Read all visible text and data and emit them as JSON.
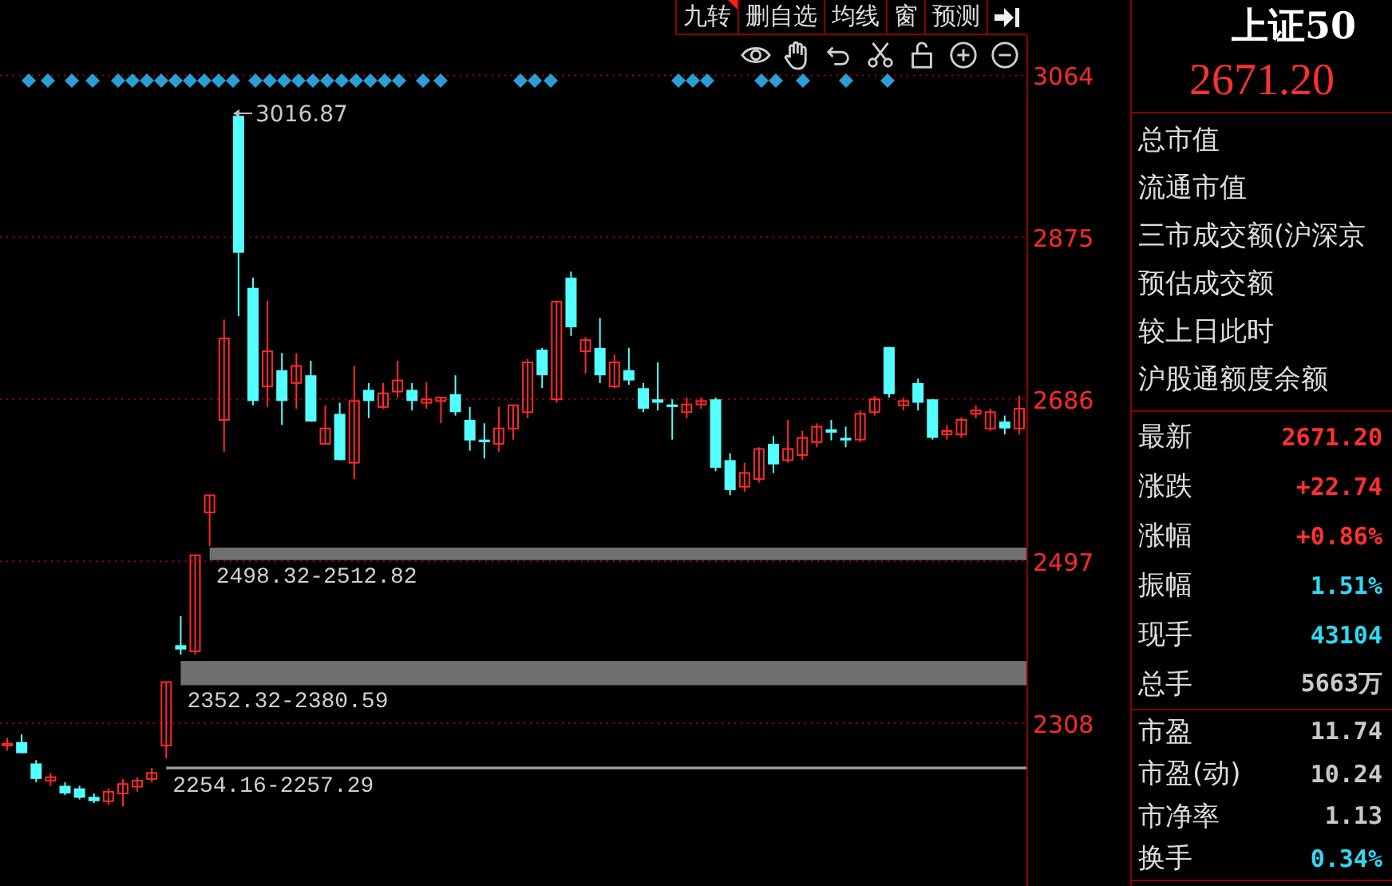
{
  "toolbar": {
    "buttons": [
      {
        "label": "九转",
        "flagged": true
      },
      {
        "label": "删自选",
        "flagged": false
      },
      {
        "label": "均线",
        "flagged": false
      },
      {
        "label": "窗",
        "flagged": false
      },
      {
        "label": "预测",
        "flagged": false
      }
    ]
  },
  "chart": {
    "peak_label": "3016.87",
    "chart_data": {
      "type": "candlestick",
      "grid": true,
      "ylim": [
        2118,
        3111
      ],
      "yticks": [
        {
          "value": 3064,
          "label": "3064"
        },
        {
          "value": 2875,
          "label": "2875"
        },
        {
          "value": 2686,
          "label": "2686"
        },
        {
          "value": 2497,
          "label": "2497"
        },
        {
          "value": 2308,
          "label": "2308"
        }
      ],
      "bands": [
        {
          "axis": "y",
          "from": 2498.32,
          "to": 2512.82,
          "label": "2498.32-2512.82"
        },
        {
          "axis": "y",
          "from": 2352.32,
          "to": 2380.59,
          "label": "2352.32-2380.59"
        },
        {
          "axis": "y",
          "from": 2254.16,
          "to": 2257.29,
          "label": "2254.16-2257.29"
        }
      ],
      "categories": [
        null,
        null,
        null,
        null,
        null,
        null,
        null,
        null,
        null,
        null,
        null,
        null,
        null,
        null,
        null,
        null,
        null,
        null,
        null,
        null,
        null,
        null,
        null,
        null,
        null,
        null,
        null,
        null,
        null,
        null,
        null,
        null,
        null,
        null,
        null,
        null,
        null,
        null,
        null,
        null,
        null,
        null,
        null,
        null,
        null,
        null,
        null,
        null,
        null,
        null,
        null,
        null,
        null,
        null,
        null,
        null,
        null,
        null,
        null,
        null,
        null,
        null,
        null,
        null,
        null,
        null,
        null,
        null,
        null,
        null,
        null
      ],
      "ohlc": [
        [
          2282,
          2291,
          2276,
          2284
        ],
        [
          2286,
          2295,
          2273,
          2273
        ],
        [
          2261,
          2265,
          2239,
          2243
        ],
        [
          2241,
          2250,
          2235,
          2245
        ],
        [
          2235,
          2239,
          2224,
          2226
        ],
        [
          2232,
          2235,
          2219,
          2221
        ],
        [
          2222,
          2226,
          2215,
          2217
        ],
        [
          2217,
          2232,
          2213,
          2228
        ],
        [
          2226,
          2243,
          2211,
          2237
        ],
        [
          2234,
          2245,
          2228,
          2241
        ],
        [
          2243,
          2256,
          2239,
          2250
        ],
        [
          2282,
          2356,
          2267,
          2356
        ],
        [
          2399,
          2433,
          2388,
          2394
        ],
        [
          2392,
          2504,
          2388,
          2504
        ],
        [
          2554,
          2574,
          2515,
          2574
        ],
        [
          2662,
          2779,
          2625,
          2757
        ],
        [
          3017,
          3017,
          2783,
          2857
        ],
        [
          2816,
          2828,
          2679,
          2684
        ],
        [
          2701,
          2801,
          2677,
          2742
        ],
        [
          2720,
          2740,
          2656,
          2684
        ],
        [
          2705,
          2740,
          2675,
          2725
        ],
        [
          2714,
          2731,
          2660,
          2660
        ],
        [
          2634,
          2679,
          2634,
          2652
        ],
        [
          2669,
          2682,
          2615,
          2615
        ],
        [
          2612,
          2725,
          2593,
          2684
        ],
        [
          2697,
          2705,
          2664,
          2684
        ],
        [
          2677,
          2705,
          2675,
          2693
        ],
        [
          2695,
          2731,
          2688,
          2708
        ],
        [
          2697,
          2705,
          2673,
          2684
        ],
        [
          2682,
          2706,
          2675,
          2686
        ],
        [
          2684,
          2688,
          2658,
          2688
        ],
        [
          2692,
          2714,
          2667,
          2671
        ],
        [
          2662,
          2677,
          2626,
          2638
        ],
        [
          2639,
          2658,
          2617,
          2636
        ],
        [
          2634,
          2677,
          2625,
          2652
        ],
        [
          2652,
          2679,
          2639,
          2679
        ],
        [
          2671,
          2733,
          2664,
          2729
        ],
        [
          2744,
          2746,
          2699,
          2714
        ],
        [
          2686,
          2800,
          2682,
          2800
        ],
        [
          2828,
          2835,
          2760,
          2770
        ],
        [
          2742,
          2759,
          2716,
          2755
        ],
        [
          2746,
          2781,
          2705,
          2714
        ],
        [
          2701,
          2738,
          2699,
          2729
        ],
        [
          2720,
          2746,
          2703,
          2708
        ],
        [
          2699,
          2705,
          2671,
          2675
        ],
        [
          2686,
          2729,
          2673,
          2682
        ],
        [
          2680,
          2686,
          2639,
          2677
        ],
        [
          2671,
          2688,
          2664,
          2680
        ],
        [
          2680,
          2688,
          2675,
          2684
        ],
        [
          2686,
          2688,
          2602,
          2606
        ],
        [
          2615,
          2623,
          2574,
          2580
        ],
        [
          2584,
          2612,
          2578,
          2600
        ],
        [
          2593,
          2630,
          2589,
          2628
        ],
        [
          2634,
          2643,
          2600,
          2610
        ],
        [
          2615,
          2662,
          2612,
          2628
        ],
        [
          2621,
          2649,
          2615,
          2641
        ],
        [
          2636,
          2658,
          2630,
          2654
        ],
        [
          2651,
          2662,
          2638,
          2647
        ],
        [
          2641,
          2654,
          2630,
          2638
        ],
        [
          2639,
          2673,
          2636,
          2669
        ],
        [
          2671,
          2690,
          2667,
          2686
        ],
        [
          2747,
          2747,
          2688,
          2692
        ],
        [
          2679,
          2688,
          2673,
          2684
        ],
        [
          2705,
          2710,
          2673,
          2682
        ],
        [
          2686,
          2686,
          2639,
          2641
        ],
        [
          2645,
          2656,
          2639,
          2649
        ],
        [
          2645,
          2665,
          2641,
          2662
        ],
        [
          2669,
          2679,
          2664,
          2673
        ],
        [
          2652,
          2675,
          2649,
          2671
        ],
        [
          2660,
          2667,
          2645,
          2652
        ],
        [
          2652,
          2690,
          2645,
          2675
        ]
      ]
    }
  },
  "quote": {
    "name": "上证50",
    "price": "2671.20",
    "market_fields": [
      "总市值",
      "流通市值",
      "三市成交额(沪深京",
      "预估成交额",
      "较上日此时",
      "沪股通额度余额"
    ],
    "stats": [
      {
        "label": "最新",
        "value": "2671.20",
        "color": "#ff3030"
      },
      {
        "label": "涨跌",
        "value": "+22.74",
        "color": "#ff3030"
      },
      {
        "label": "涨幅",
        "value": "+0.86%",
        "color": "#ff3030"
      },
      {
        "label": "振幅",
        "value": "1.51%",
        "color": "#30d8f0"
      },
      {
        "label": "现手",
        "value": "43104",
        "color": "#30d8f0"
      },
      {
        "label": "总手",
        "value": "5663万",
        "color": "#c8c8c8"
      }
    ],
    "valuation": [
      {
        "label": "市盈",
        "value": "11.74",
        "color": "#c8c8c8"
      },
      {
        "label": "市盈(动)",
        "value": "10.24",
        "color": "#c8c8c8"
      },
      {
        "label": "市净率",
        "value": "1.13",
        "color": "#c8c8c8"
      },
      {
        "label": "换手",
        "value": "0.34%",
        "color": "#30d8f0"
      }
    ]
  }
}
